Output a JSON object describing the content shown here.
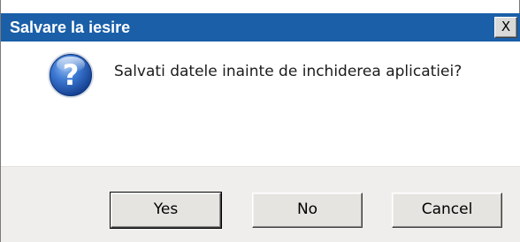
{
  "window": {
    "title": "Salvare la iesire",
    "close_glyph": "X",
    "accent_color": "#1a5fa8"
  },
  "message": {
    "icon": "question-icon",
    "text": "Salvati datele inainte de inchiderea aplicatiei?"
  },
  "buttons": {
    "yes_label": "Yes",
    "no_label": "No",
    "cancel_label": "Cancel"
  }
}
